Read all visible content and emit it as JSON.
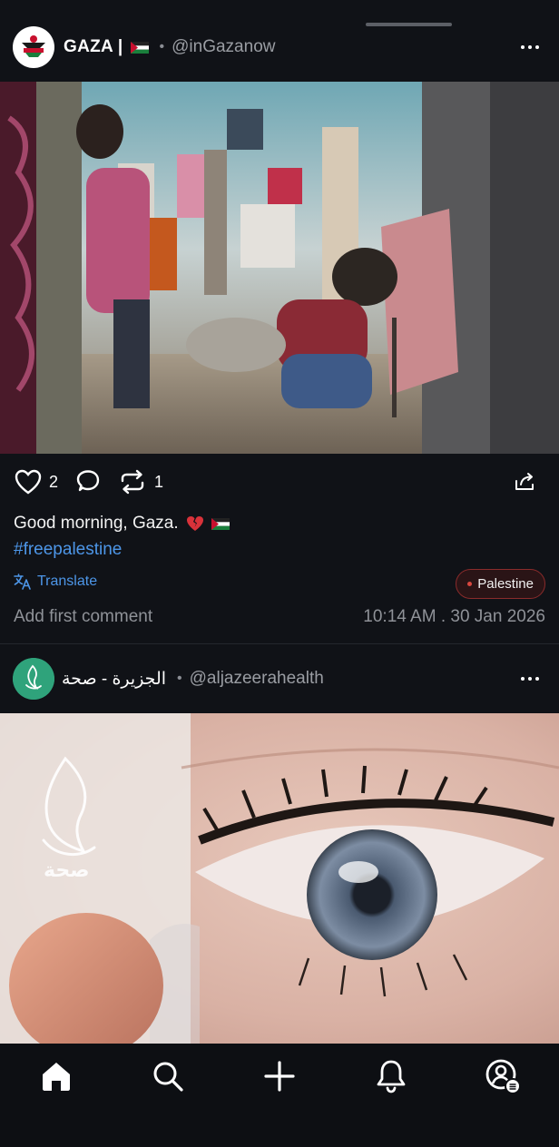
{
  "feed": {
    "post1": {
      "display_name": "GAZA |",
      "handle": "@inGazanow",
      "like_count": "2",
      "repost_count": "1",
      "caption": "Good morning, Gaza.",
      "hashtag": "#freepalestine",
      "translate_label": "Translate",
      "topic_chip": "Palestine",
      "add_comment_label": "Add first comment",
      "timestamp": "10:14 AM . 30 Jan 2026"
    },
    "post2": {
      "display_name": "الجزيرة - صحة",
      "handle": "@aljazeerahealth",
      "image_watermark": "صحة"
    }
  },
  "icons": {
    "like": "heart-icon",
    "comment": "comment-icon",
    "repost": "repost-icon",
    "share": "share-icon",
    "more": "more-icon",
    "translate": "translate-icon",
    "broken_heart": "broken-heart-emoji",
    "flag": "palestine-flag-emoji"
  },
  "bottom_nav": [
    "home-icon",
    "search-icon",
    "compose-icon",
    "notifications-icon",
    "profile-icon"
  ],
  "colors": {
    "background": "#101217",
    "link": "#4d96e8",
    "chip_border": "#8a2b2b",
    "avatar_aj": "#2fa37b"
  }
}
